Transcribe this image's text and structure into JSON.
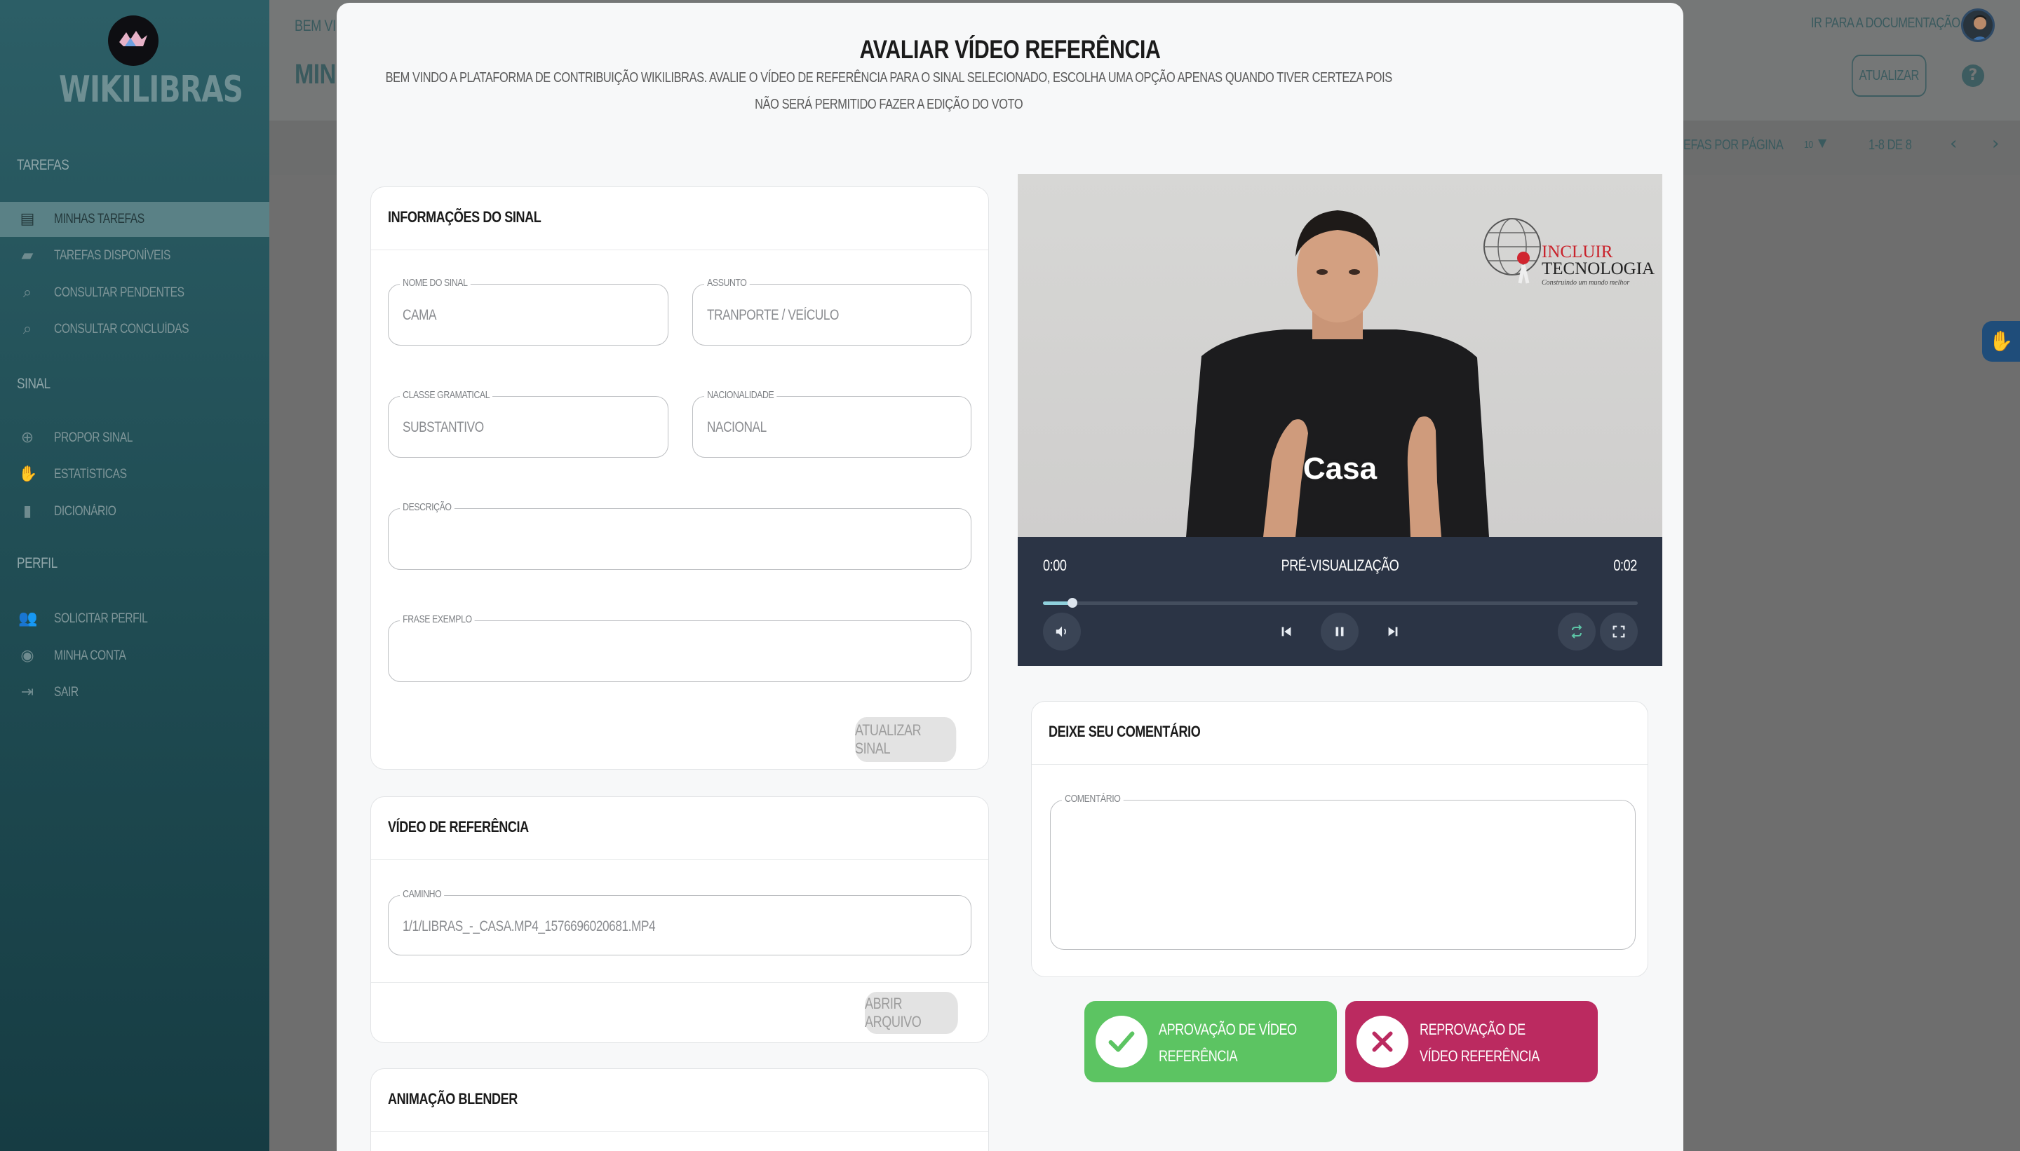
{
  "sidebar": {
    "logo_text": "WIKILIBRAS",
    "sections": {
      "tarefas": "TAREFAS",
      "sinal": "SINAL",
      "perfil": "PERFIL"
    },
    "items": [
      {
        "label": "MINHAS TAREFAS",
        "icon": "clipboard-icon",
        "active": true
      },
      {
        "label": "TAREFAS DISPONÍVEIS",
        "icon": "folder-add-icon",
        "active": false
      },
      {
        "label": "CONSULTAR PENDENTES",
        "icon": "search-document-icon",
        "active": false
      },
      {
        "label": "CONSULTAR CONCLUÍDAS",
        "icon": "search-image-icon",
        "active": false
      },
      {
        "label": "PROPOR SINAL",
        "icon": "plus-circle-icon",
        "active": false
      },
      {
        "label": "ESTATÍSTICAS",
        "icon": "hand-icon",
        "active": false
      },
      {
        "label": "DICIONÁRIO",
        "icon": "book-icon",
        "active": false
      },
      {
        "label": "SOLICITAR PERFIL",
        "icon": "people-icon",
        "active": false
      },
      {
        "label": "MINHA CONTA",
        "icon": "account-circle-icon",
        "active": false
      },
      {
        "label": "SAIR",
        "icon": "logout-icon",
        "active": false
      }
    ]
  },
  "background": {
    "welcome": "BEM VI",
    "page_title": "MINH",
    "doc_link": "IR PARA A DOCUMENTAÇÃO",
    "update_button": "ATUALIZAR",
    "per_page_label": "EFAS POR PÁGINA",
    "per_page_value": "10",
    "range": "1-8 DE 8"
  },
  "modal": {
    "title": "AVALIAR VÍDEO REFERÊNCIA",
    "subtitle_line1": "BEM VINDO A PLATAFORMA DE CONTRIBUIÇÃO WIKILIBRAS. AVALIE O VÍDEO DE REFERÊNCIA PARA O SINAL SELECIONADO, ESCOLHA UMA OPÇÃO APENAS QUANDO TIVER CERTEZA POIS",
    "subtitle_line2": "NÃO SERÁ PERMITIDO FAZER A EDIÇÃO DO VOTO",
    "sign_info": {
      "header": "INFORMAÇÕES DO SINAL",
      "nome_label": "NOME DO SINAL",
      "nome_value": "CAMA",
      "assunto_label": "ASSUNTO",
      "assunto_value": "TRANPORTE / VEÍCULO",
      "classe_label": "CLASSE GRAMATICAL",
      "classe_value": "SUBSTANTIVO",
      "nacionalidade_label": "NACIONALIDADE",
      "nacionalidade_value": "NACIONAL",
      "descricao_label": "DESCRIÇÃO",
      "descricao_value": "",
      "frase_label": "FRASE EXEMPLO",
      "frase_value": "",
      "update_button": "ATUALIZAR SINAL"
    },
    "reference_video": {
      "header": "VÍDEO DE REFERÊNCIA",
      "caminho_label": "CAMINHO",
      "caminho_value": "1/1/LIBRAS_-_CASA.MP4_1576696020681.MP4",
      "open_button": "ABRIR ARQUIVO"
    },
    "blender": {
      "header": "ANIMAÇÃO BLENDER"
    },
    "player": {
      "caption": "Casa",
      "logo_top": "INCLUIR",
      "logo_mid": "TECNOLOGIA",
      "logo_tag": "Construindo um mundo melhor",
      "time_current": "0:00",
      "time_total": "0:02",
      "mode_label": "PRÉ-VISUALIZAÇÃO",
      "progress": 0.05
    },
    "comment": {
      "header": "DEIXE SEU COMENTÁRIO",
      "label": "COMENTÁRIO",
      "value": ""
    },
    "approve_label": "APROVAÇÃO DE VÍDEO REFERÊNCIA",
    "reject_label": "REPROVAÇÃO DE VÍDEO REFERÊNCIA"
  },
  "colors": {
    "approve": "#5cc462",
    "reject": "#bb2a60",
    "sidebar_active": "#5a8186",
    "player_bg": "#2b3445"
  }
}
